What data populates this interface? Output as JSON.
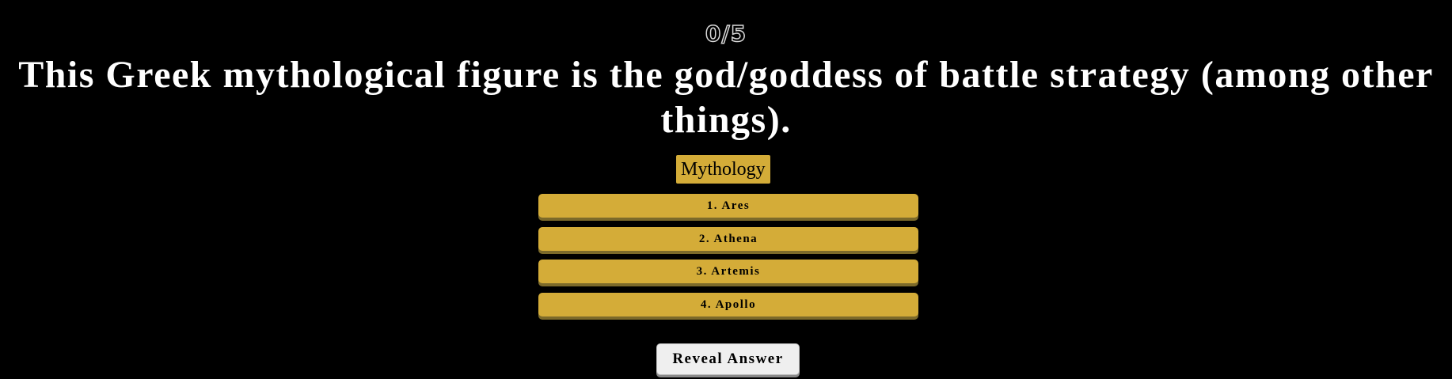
{
  "quiz": {
    "score": "0/5",
    "question": "This Greek mythological figure is the god/goddess of battle strategy (among other things).",
    "category": "Mythology",
    "options": [
      {
        "label": "1. Ares"
      },
      {
        "label": "2. Athena"
      },
      {
        "label": "3. Artemis"
      },
      {
        "label": "4. Apollo"
      }
    ],
    "reveal_label": "Reveal Answer"
  },
  "colors": {
    "background": "#000000",
    "accent_gold": "#d4ac38",
    "button_light": "#efefef",
    "text": "#ffffff"
  }
}
